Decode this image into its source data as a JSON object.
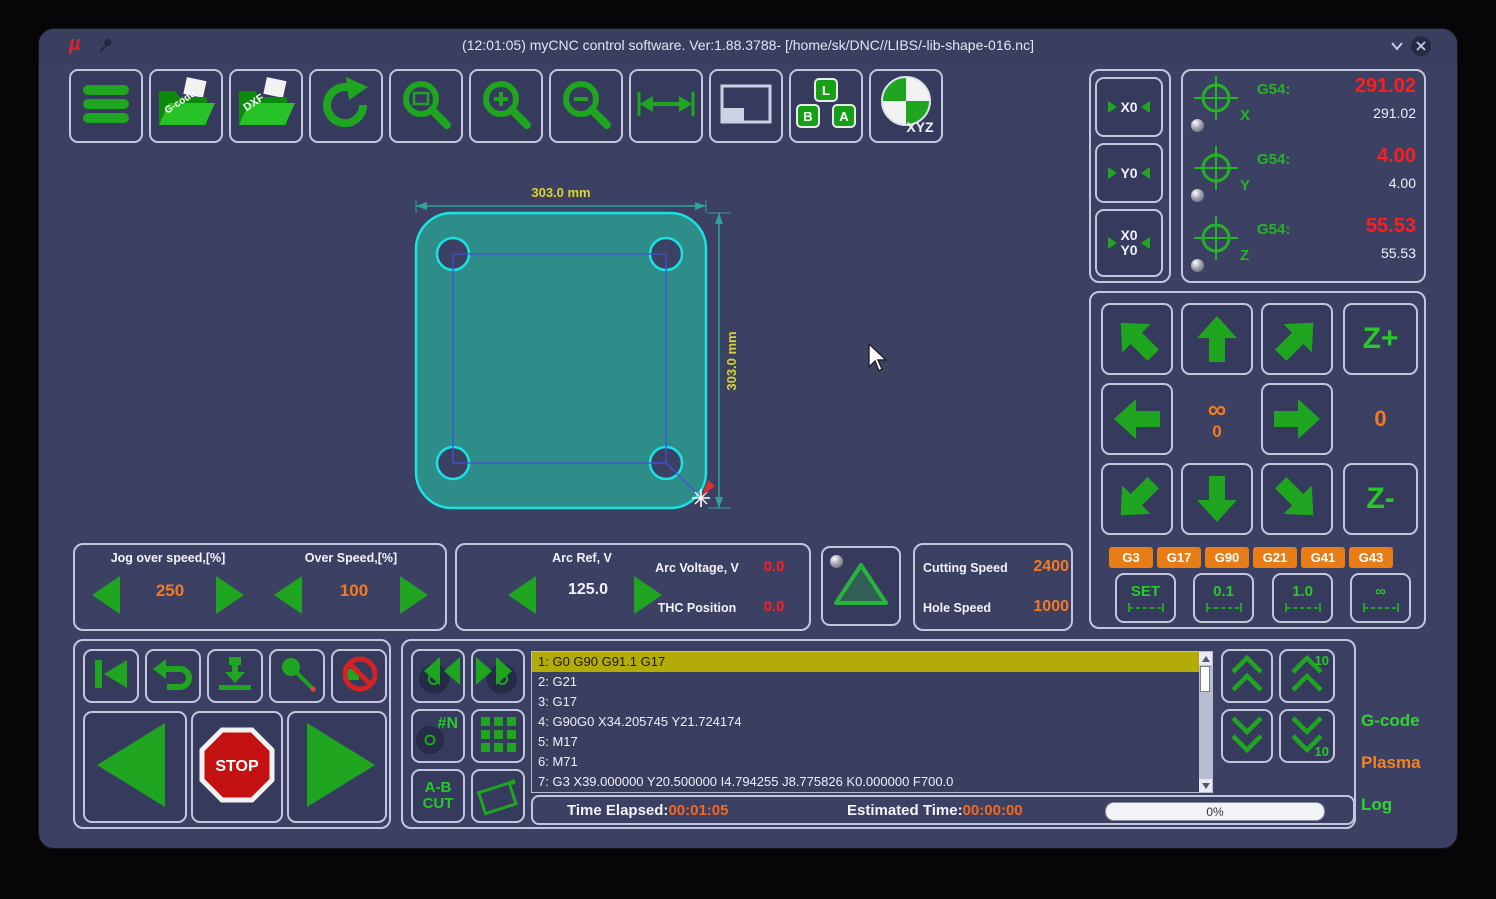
{
  "window": {
    "title": "(12:01:05) myCNC control software. Ver:1.88.3788- [/home/sk/DNC//LIBS/-lib-shape-016.nc]",
    "logo": "µ"
  },
  "toolbar": {
    "gcode_label": "G-code",
    "dxf_label": "DXF",
    "xyz_label": "XYZ",
    "keys": {
      "top": "L",
      "left": "B",
      "right": "A"
    }
  },
  "dro": {
    "zero_x": "X0",
    "zero_y": "Y0",
    "zero_xy_line1": "X0",
    "zero_xy_line2": "Y0",
    "axes": [
      {
        "name": "X",
        "offset_label": "G54:",
        "value": "291.02",
        "machine": "291.02"
      },
      {
        "name": "Y",
        "offset_label": "G54:",
        "value": "4.00",
        "machine": "4.00"
      },
      {
        "name": "Z",
        "offset_label": "G54:",
        "value": "55.53",
        "machine": "55.53"
      }
    ]
  },
  "jog": {
    "infinity": "∞",
    "center_value": "0",
    "aux_value": "0",
    "z_plus": "Z+",
    "z_minus": "Z-",
    "gcode_chips": [
      "G3",
      "G17",
      "G90",
      "G21",
      "G41",
      "G43"
    ],
    "step_buttons": [
      "SET",
      "0.1",
      "1.0",
      "∞"
    ]
  },
  "speeds": {
    "jog_label": "Jog over speed,[%]",
    "jog_value": "250",
    "over_label": "Over Speed,[%]",
    "over_value": "100"
  },
  "thc": {
    "arc_ref_label": "Arc Ref, V",
    "arc_ref_value": "125.0",
    "arc_voltage_label": "Arc Voltage, V",
    "arc_voltage_value": "0.0",
    "thc_position_label": "THC Position",
    "thc_position_value": "0.0"
  },
  "cut": {
    "cutting_label": "Cutting Speed",
    "cutting_value": "2400",
    "hole_label": "Hole Speed",
    "hole_value": "1000"
  },
  "playback": {
    "stop": "STOP"
  },
  "program": {
    "hash_n": "#N",
    "ab_line1": "A-B",
    "ab_line2": "CUT",
    "step10": "10",
    "lines": [
      "1: G0 G90 G91.1 G17",
      "2: G21",
      "3: G17",
      "4: G90G0 X34.205745 Y21.724174",
      "5: M17",
      "6: M71",
      "7: G3 X39.000000 Y20.500000 I4.794255 J8.775826 K0.000000 F700.0"
    ]
  },
  "status": {
    "elapsed_label": "Time Elapsed:",
    "elapsed_value": "00:01:05",
    "estimated_label": "Estimated Time:",
    "estimated_value": "00:00:00",
    "progress": "0%"
  },
  "tabs": [
    {
      "label": "G-code"
    },
    {
      "label": "Plasma"
    },
    {
      "label": "Log"
    }
  ],
  "drawing": {
    "width_dim": "303.0 mm",
    "height_dim": "303.0 mm"
  },
  "colors": {
    "green": "#1fa51f",
    "orange": "#f5821f",
    "red": "#ff1e1e",
    "cyan": "#1ae2e2",
    "chip_orange": "#e87d18"
  }
}
